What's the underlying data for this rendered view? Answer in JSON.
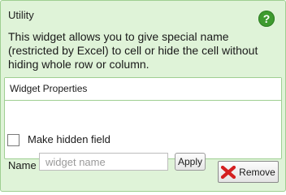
{
  "widget": {
    "title": "Utility",
    "help_glyph": "?",
    "description": "This widget allows you to give special name (restricted by Excel) to cell or hide the cell without hiding whole row or column."
  },
  "properties": {
    "header": "Widget Properties",
    "hidden_field": {
      "label": "Make hidden field",
      "checked": false
    },
    "name_field": {
      "label": "Name",
      "value": "",
      "placeholder": "widget name"
    },
    "apply_label": "Apply"
  },
  "actions": {
    "remove_label": "Remove",
    "remove_icon": "close-x-icon"
  },
  "colors": {
    "panel_bg": "#dff3d8",
    "border": "#9fcf92",
    "help_icon": "#3e9b2f",
    "remove_icon": "#d42020"
  }
}
